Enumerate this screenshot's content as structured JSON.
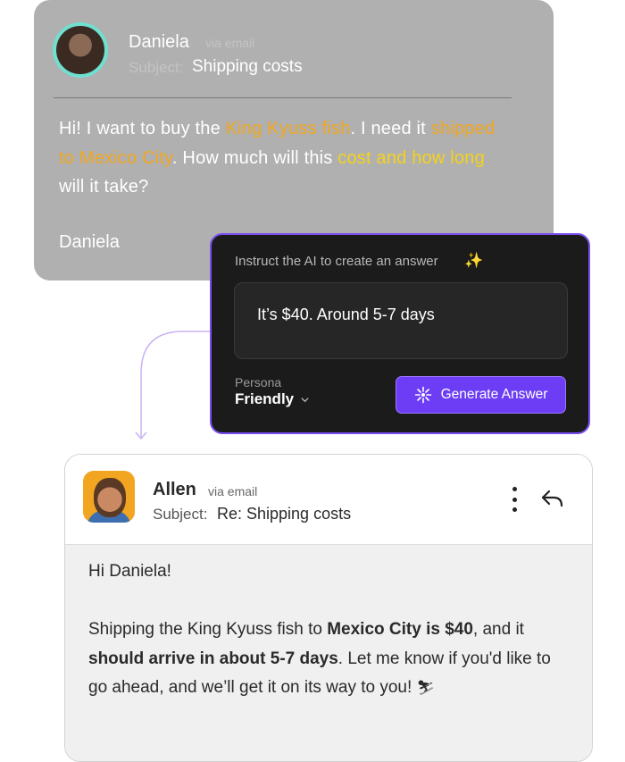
{
  "incoming": {
    "sender_name": "Daniela",
    "via": "via email",
    "subject_label": "Subject:",
    "subject": "Shipping costs",
    "body": {
      "p1": "Hi! I want to buy the ",
      "h1": "King Kyuss fish",
      "p2": ". I need it ",
      "h2": "shipped to Mexico City",
      "p3": ". How much will this ",
      "h3": "cost and how long",
      "p4": " will it take?"
    },
    "signature": "Daniela",
    "colors": {
      "card": "#b0b0b0",
      "highlight_orange": "#f2a61f",
      "highlight_yellow": "#f5d21a"
    }
  },
  "ai_panel": {
    "title": "Instruct the AI to create an answer",
    "sparkle_icon": "sparkle-icon",
    "input_value": "It’s $40. Around 5-7 days",
    "persona_label": "Persona",
    "persona_value": "Friendly",
    "generate_label": "Generate Answer",
    "colors": {
      "accent": "#6d3df5",
      "border": "#7b4df0"
    }
  },
  "reply": {
    "sender_name": "Allen",
    "via": "via email",
    "subject_label": "Subject:",
    "subject": "Re: Shipping costs",
    "greeting": "Hi Daniela!",
    "body": {
      "t1": "Shipping the King Kyuss fish to ",
      "b1": "Mexico City is $40",
      "t2": ", and it ",
      "b2": "should arrive in about 5-7 days",
      "t3": ". Let me know if you'd like to go ahead, and we’ll get it on its way to you! ",
      "emoji": "⛷"
    },
    "icons": {
      "more": "more-vertical-icon",
      "reply": "reply-arrow-icon"
    }
  }
}
